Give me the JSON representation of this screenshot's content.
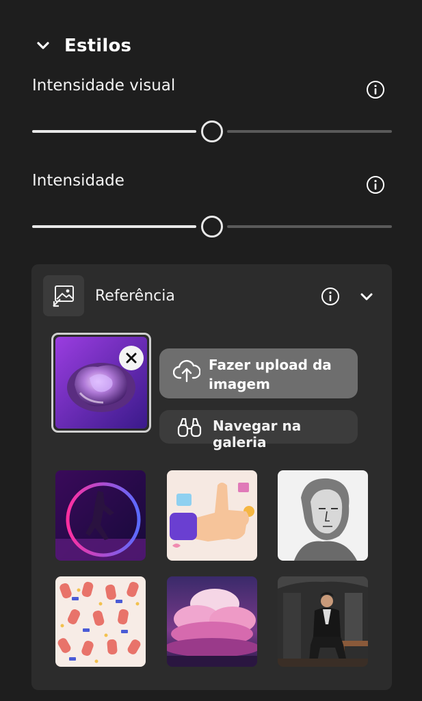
{
  "styles_section": {
    "title": "Estilos",
    "visual_intensity": {
      "label": "Intensidade visual",
      "value_percent": 50
    },
    "intensity": {
      "label": "Intensidade",
      "value_percent": 50
    }
  },
  "reference_panel": {
    "title": "Referência",
    "upload_button_label": "Fazer upload da imagem",
    "gallery_button_label": "Navegar na galeria",
    "gallery_items": [
      "neon-ring-dancer",
      "thumbs-up-hand",
      "engraved-portrait",
      "hand-gestures-pattern",
      "pink-clouds",
      "seated-man-portrait"
    ]
  },
  "colors": {
    "background": "#1e1e1e",
    "panel": "#2c2c2c",
    "upload_button": "#6e6e6e",
    "gallery_button": "#3c3c3c"
  }
}
